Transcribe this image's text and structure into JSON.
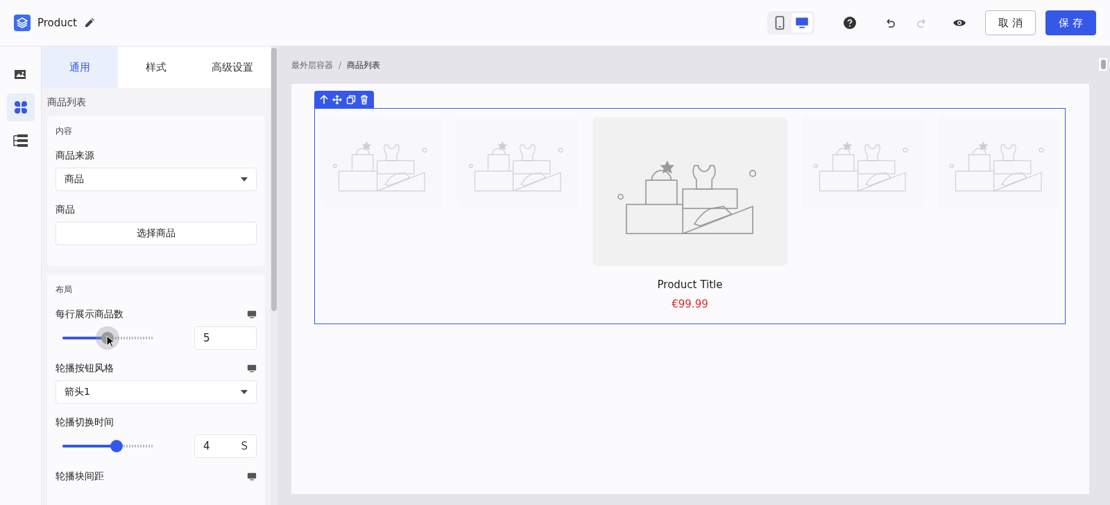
{
  "header": {
    "title": "Product",
    "devices": [
      {
        "kind": "mobile",
        "selected": false
      },
      {
        "kind": "desktop",
        "selected": true
      }
    ],
    "undo_disabled": false,
    "redo_disabled": true,
    "cancel": "取 消",
    "save": "保 存"
  },
  "rail": [
    {
      "kind": "images",
      "selected": false
    },
    {
      "kind": "components",
      "selected": true
    },
    {
      "kind": "layers",
      "selected": false
    }
  ],
  "tabs": [
    {
      "label": "通用",
      "selected": true
    },
    {
      "label": "样式",
      "selected": false
    },
    {
      "label": "高级设置",
      "selected": false
    }
  ],
  "panel_title": "商品列表",
  "sections": [
    {
      "title": "内容",
      "fields": [
        {
          "kind": "select",
          "label": "商品来源",
          "value": "商品",
          "device_icon": false
        },
        {
          "kind": "button",
          "label": "商品",
          "value": "选择商品",
          "device_icon": false
        }
      ]
    },
    {
      "title": "布局",
      "fields": [
        {
          "kind": "slider",
          "label": "每行展示商品数",
          "value": "5",
          "level": 0.5,
          "active": true,
          "device_icon": true
        },
        {
          "kind": "select",
          "label": "轮播按钮风格",
          "value": "箭头1",
          "device_icon": true
        },
        {
          "kind": "slider",
          "label": "轮播切换时间",
          "value": "4",
          "unit": "S",
          "level": 0.6,
          "active": false,
          "device_icon": false
        },
        {
          "kind": "heading",
          "label": "轮播块间距",
          "device_icon": true
        }
      ]
    }
  ],
  "breadcrumb_separator": "/",
  "breadcrumb": [
    {
      "label": "最外层容器",
      "selected": false
    },
    {
      "label": "商品列表",
      "selected": true
    }
  ],
  "products": [
    {
      "active": false
    },
    {
      "active": false
    },
    {
      "active": true,
      "title": "Product Title",
      "price": "€99.99"
    },
    {
      "active": false
    },
    {
      "active": false
    }
  ]
}
